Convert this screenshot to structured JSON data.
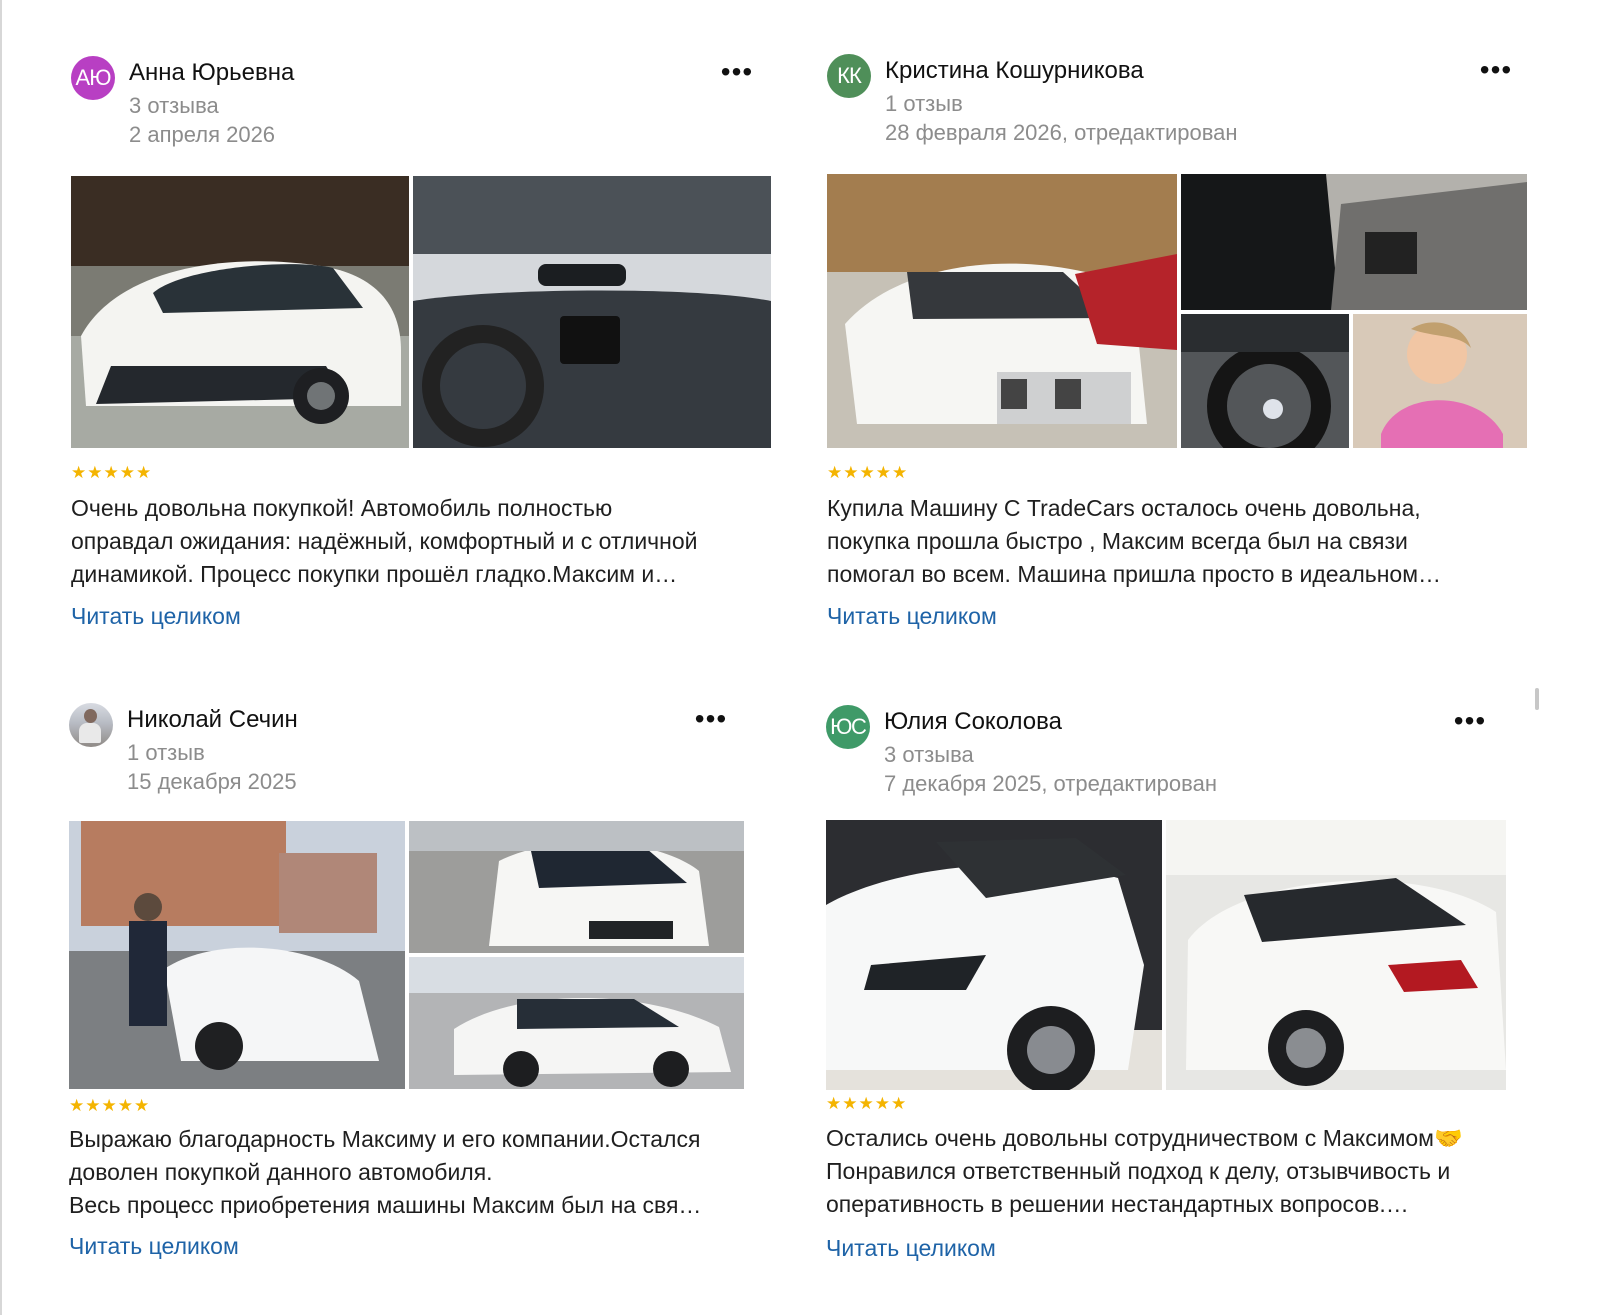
{
  "reviews": [
    {
      "avatar_initials": "АЮ",
      "avatar_color": "#b83fc3",
      "author": "Анна Юрьевна",
      "reviews_count": "3 отзыва",
      "date": "2 апреля 2026",
      "photos": [
        "white Toyota sedan exterior",
        "Toyota dashboard interior"
      ],
      "stars": "★★★★★",
      "text_lines": [
        "Очень довольна покупкой! Автомобиль полностью",
        "оправдал ожидания: надёжный, комфортный и с отличной",
        "динамикой. Процесс покупки прошёл гладко.Максим и…"
      ],
      "read_more": "Читать целиком",
      "more_icon": "more-horizontal-icon"
    },
    {
      "avatar_initials": "КК",
      "avatar_color": "#4f8f59",
      "author": "Кристина Кошурникова",
      "reviews_count": "1 отзыв",
      "date": "28 февраля 2026, отредактирован",
      "photos": [
        "white BMW SUV in forest parking",
        "car rear seat interior",
        "BMW steering wheel",
        "woman in pink jacket selfie"
      ],
      "stars": "★★★★★",
      "text_lines": [
        "Купила Машину С TradeCars осталось очень довольна,",
        "покупка прошла быстро , Максим всегда был на связи",
        "помогал во всем. Машина пришла просто в идеальном…"
      ],
      "read_more": "Читать целиком",
      "more_icon": "more-horizontal-icon"
    },
    {
      "avatar_initials": "",
      "avatar_color": "#b8bcc4",
      "author": "Николай Сечин",
      "reviews_count": "1 отзыв",
      "date": "15 декабря 2025",
      "photos": [
        "man next to white sedan",
        "white sedan front angle",
        "white sedan side angle"
      ],
      "stars": "★★★★★",
      "text_lines": [
        "Выражаю благодарность Максиму и его компании.Остался",
        "доволен покупкой данного автомобиля.",
        "Весь процесс приобретения машины Максим был на свя…"
      ],
      "read_more": "Читать целиком",
      "more_icon": "more-horizontal-icon"
    },
    {
      "avatar_initials": "ЮС",
      "avatar_color": "#3f9a68",
      "author": "Юлия Соколова",
      "reviews_count": "3 отзыва",
      "date": "7 декабря 2025, отредактирован",
      "photos": [
        "white Toyota SUV front",
        "white Toyota SUV rear"
      ],
      "stars": "★★★★★",
      "text_lines": [
        "Остались очень довольны сотрудничеством с Максимом🤝",
        "Понравился ответственный подход к делу, отзывчивость и",
        "оперативность в решении нестандартных вопросов.…"
      ],
      "read_more": "Читать целиком",
      "more_icon": "more-horizontal-icon"
    }
  ],
  "colors": {
    "link": "#1e63a7",
    "stars": "#f4b400",
    "meta": "#8c8c8c"
  }
}
